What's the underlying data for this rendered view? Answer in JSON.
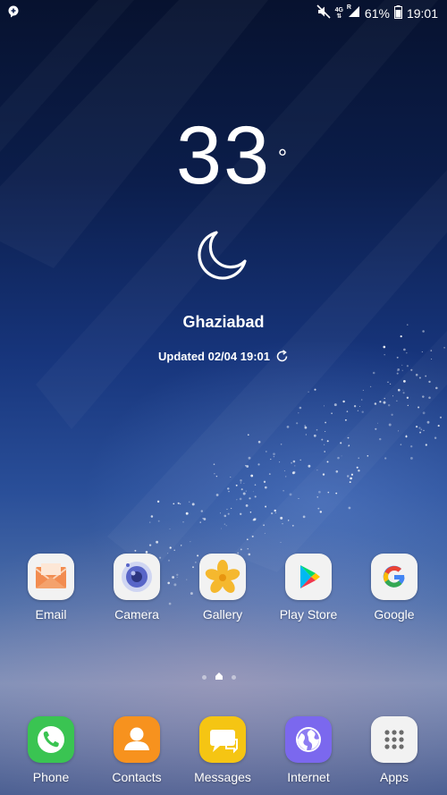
{
  "status_bar": {
    "battery_percent": "61%",
    "time": "19:01",
    "network_label": "4G",
    "roaming_label": "R",
    "icons": [
      "notification-icon",
      "mute-icon",
      "network-icon",
      "signal-icon",
      "battery-icon"
    ]
  },
  "weather": {
    "temperature": "33",
    "degree_symbol": "°",
    "condition_icon": "moon-icon",
    "city": "Ghaziabad",
    "updated": "Updated 02/04 19:01",
    "refresh_icon": "refresh-icon"
  },
  "home_apps": [
    {
      "label": "Email",
      "icon": "email-icon"
    },
    {
      "label": "Camera",
      "icon": "camera-icon"
    },
    {
      "label": "Gallery",
      "icon": "gallery-icon"
    },
    {
      "label": "Play Store",
      "icon": "play-store-icon"
    },
    {
      "label": "Google",
      "icon": "google-icon"
    }
  ],
  "page_indicator": {
    "pages": 3,
    "current_is_home": true
  },
  "dock": [
    {
      "label": "Phone",
      "icon": "phone-icon",
      "color": "#3ac452"
    },
    {
      "label": "Contacts",
      "icon": "contacts-icon",
      "color": "#f7921e"
    },
    {
      "label": "Messages",
      "icon": "messages-icon",
      "color": "#f5c513"
    },
    {
      "label": "Internet",
      "icon": "internet-icon",
      "color": "#7b68ee"
    },
    {
      "label": "Apps",
      "icon": "apps-grid-icon",
      "color": "#f2f2f2"
    }
  ]
}
